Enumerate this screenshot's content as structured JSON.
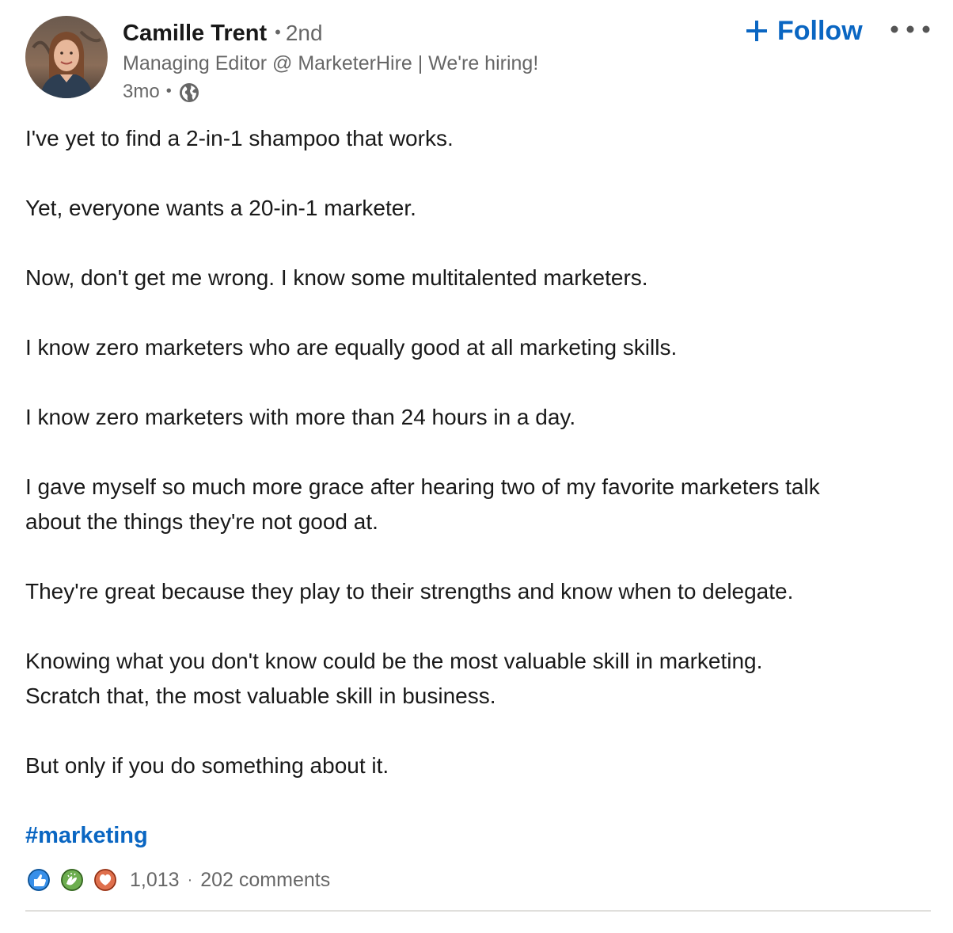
{
  "author": {
    "name": "Camille Trent",
    "separator": "•",
    "degree": "2nd",
    "headline": "Managing Editor @ MarketerHire | We're hiring!",
    "time": "3mo",
    "time_separator": "•",
    "visibility_icon": "globe-icon"
  },
  "actions": {
    "follow_label": "Follow",
    "follow_icon": "plus-icon",
    "more_icon": "more-horizontal-icon"
  },
  "post": {
    "paragraphs": [
      [
        "I've yet to find a 2-in-1 shampoo that works."
      ],
      [
        "Yet, everyone wants a 20-in-1 marketer."
      ],
      [
        "Now, don't get me wrong. I know some multitalented marketers."
      ],
      [
        "I know zero marketers who are equally good at all marketing skills."
      ],
      [
        "I know zero marketers with more than 24 hours in a day."
      ],
      [
        "I gave myself so much more grace after hearing two of my favorite marketers talk",
        "about the things they're not good at."
      ],
      [
        "They're great because they play to their strengths and know when to delegate."
      ],
      [
        "Knowing what you don't know could be the most valuable skill in marketing.",
        "Scratch that, the most valuable skill in business."
      ],
      [
        "But only if you do something about it."
      ]
    ],
    "hashtag": "#marketing"
  },
  "social": {
    "reactions": [
      "like-reaction-icon",
      "celebrate-reaction-icon",
      "love-reaction-icon"
    ],
    "reaction_count": "1,013",
    "separator": "·",
    "comments": "202 comments"
  },
  "colors": {
    "brand_blue": "#0a66c2",
    "text_primary": "#1a1a1a",
    "text_secondary": "#666666",
    "like_blue": "#378fe9",
    "celebrate_green": "#44712e",
    "love_red": "#df704d",
    "divider": "#e0dfdc"
  }
}
